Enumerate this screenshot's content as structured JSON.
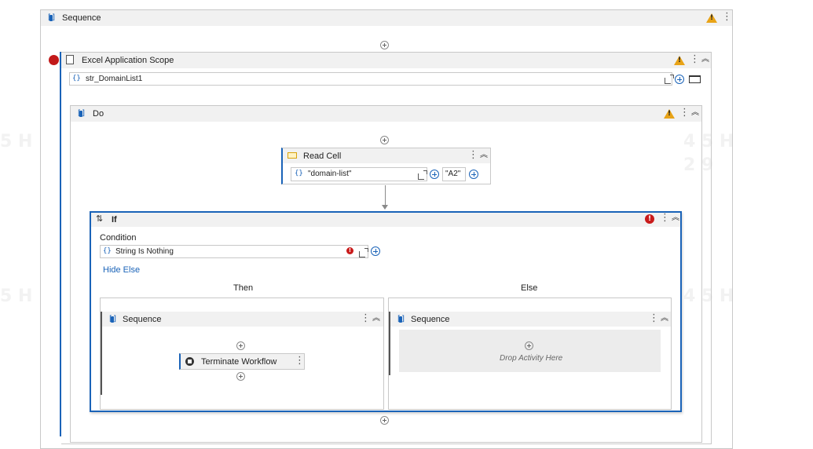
{
  "outer_sequence": {
    "title": "Sequence"
  },
  "excel_scope": {
    "title": "Excel Application Scope",
    "workbook_path": "str_DomainList1"
  },
  "do_sequence": {
    "title": "Do"
  },
  "read_cell": {
    "title": "Read Cell",
    "sheet_name": "\"domain-list\"",
    "cell": "\"A2\""
  },
  "if_activity": {
    "title": "If",
    "condition_label": "Condition",
    "condition_value": "String Is Nothing",
    "hide_else": "Hide Else",
    "then_label": "Then",
    "else_label": "Else",
    "then_sequence": {
      "title": "Sequence",
      "child": "Terminate Workflow"
    },
    "else_sequence": {
      "title": "Sequence",
      "drop_hint": "Drop Activity Here"
    }
  },
  "colors": {
    "accent": "#1a63b8",
    "warning": "#e8a317",
    "error": "#c91b1b",
    "breakpoint": "#c21a1a"
  }
}
